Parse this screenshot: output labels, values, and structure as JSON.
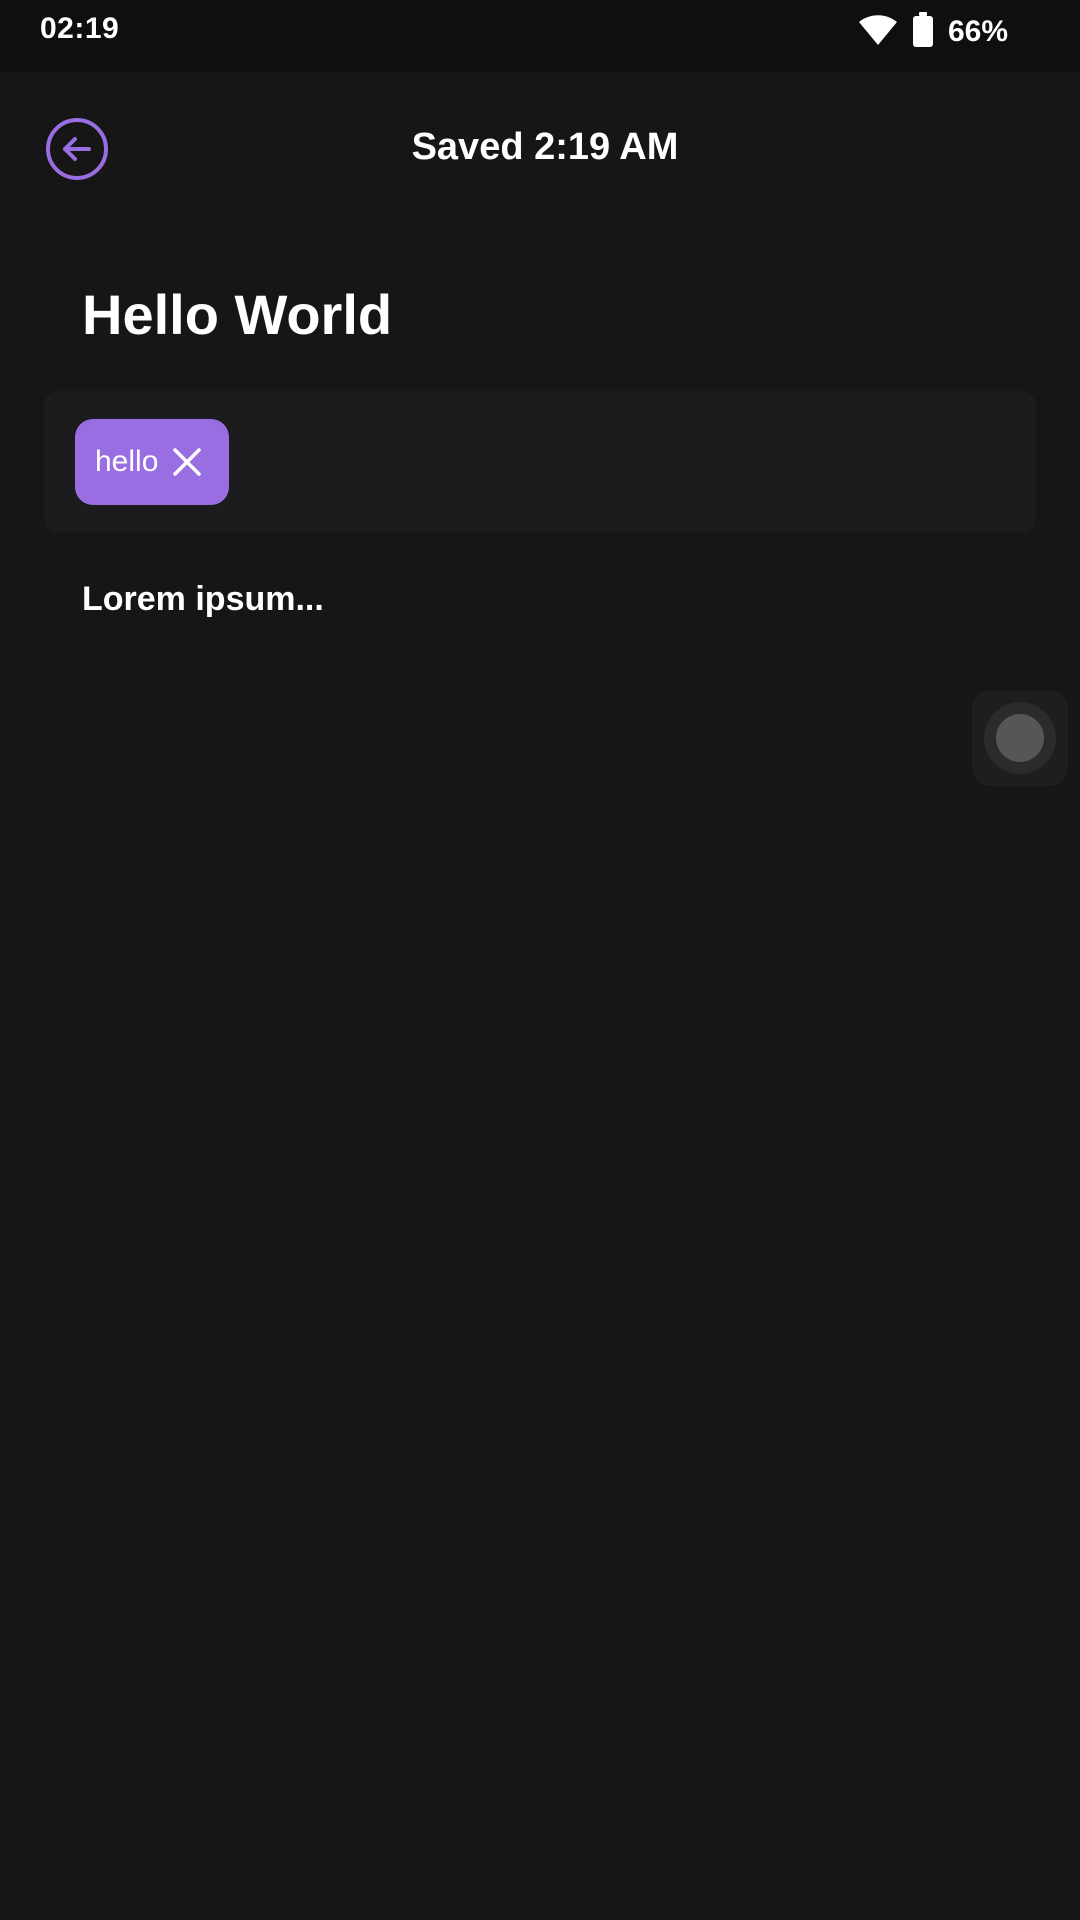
{
  "status_bar": {
    "time": "02:19",
    "battery_percent": "66%",
    "icons": [
      "wifi-icon",
      "battery-icon"
    ]
  },
  "header": {
    "back_icon": "arrow-left-circle-icon",
    "title": "Saved 2:19 AM"
  },
  "note": {
    "title": "Hello World",
    "body": "Lorem ipsum..."
  },
  "tags": [
    {
      "label": "hello",
      "remove_icon": "close-icon"
    }
  ],
  "colors": {
    "accent": "#9a6ee3",
    "background": "#161616",
    "panel": "#1c1c1e",
    "status_bar": "#0f0f0f",
    "text": "#ffffff"
  }
}
